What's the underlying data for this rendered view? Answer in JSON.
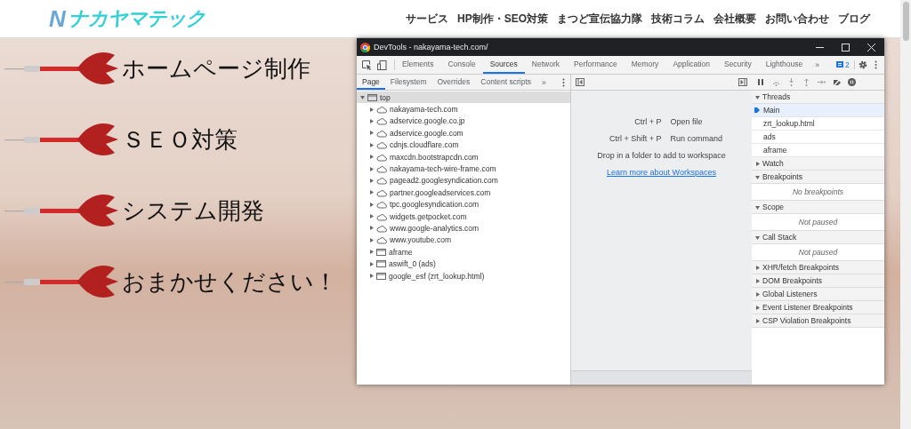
{
  "site_header": {
    "logo": {
      "initial": "N",
      "text": "ナカヤマテック"
    },
    "nav": [
      "サービス",
      "HP制作・SEO対策",
      "まつど宣伝協力隊",
      "技術コラム",
      "会社概要",
      "お問い合わせ",
      "ブログ"
    ]
  },
  "hero": {
    "items": [
      "ホームページ制作",
      "ＳＥＯ対策",
      "システム開発",
      "おまかせください！"
    ]
  },
  "devtools": {
    "title": "DevTools - nakayama-tech.com/",
    "tabs": [
      {
        "label": "Elements",
        "selected": false
      },
      {
        "label": "Console",
        "selected": false
      },
      {
        "label": "Sources",
        "selected": true
      },
      {
        "label": "Network",
        "selected": false
      },
      {
        "label": "Performance",
        "selected": false
      },
      {
        "label": "Memory",
        "selected": false
      },
      {
        "label": "Application",
        "selected": false
      },
      {
        "label": "Security",
        "selected": false
      },
      {
        "label": "Lighthouse",
        "selected": false
      }
    ],
    "more": "»",
    "issues_count": "2",
    "navigator": {
      "tabs": [
        {
          "label": "Page",
          "selected": true
        },
        {
          "label": "Filesystem",
          "selected": false
        },
        {
          "label": "Overrides",
          "selected": false
        },
        {
          "label": "Content scripts",
          "selected": false
        }
      ],
      "more": "»",
      "tree": [
        {
          "label": "top",
          "kind": "frame",
          "expanded": true,
          "selected": true,
          "children": [
            {
              "label": "nakayama-tech.com",
              "kind": "cloud",
              "expanded": false
            },
            {
              "label": "adservice.google.co.jp",
              "kind": "cloud",
              "expanded": false
            },
            {
              "label": "adservice.google.com",
              "kind": "cloud",
              "expanded": false
            },
            {
              "label": "cdnjs.cloudflare.com",
              "kind": "cloud",
              "expanded": false
            },
            {
              "label": "maxcdn.bootstrapcdn.com",
              "kind": "cloud",
              "expanded": false
            },
            {
              "label": "nakayama-tech-wire-frame.com",
              "kind": "cloud",
              "expanded": false
            },
            {
              "label": "pagead2.googlesyndication.com",
              "kind": "cloud",
              "expanded": false
            },
            {
              "label": "partner.googleadservices.com",
              "kind": "cloud",
              "expanded": false
            },
            {
              "label": "tpc.googlesyndication.com",
              "kind": "cloud",
              "expanded": false
            },
            {
              "label": "widgets.getpocket.com",
              "kind": "cloud",
              "expanded": false
            },
            {
              "label": "www.google-analytics.com",
              "kind": "cloud",
              "expanded": false
            },
            {
              "label": "www.youtube.com",
              "kind": "cloud",
              "expanded": false
            },
            {
              "label": "aframe",
              "kind": "frame",
              "expanded": false
            },
            {
              "label": "aswift_0 (ads)",
              "kind": "frame",
              "expanded": false
            },
            {
              "label": "google_esf (zrt_lookup.html)",
              "kind": "frame",
              "expanded": false
            }
          ]
        }
      ]
    },
    "editor": {
      "shortcuts": [
        {
          "keys": "Ctrl + P",
          "action": "Open file"
        },
        {
          "keys": "Ctrl + Shift + P",
          "action": "Run command"
        }
      ],
      "hint": "Drop in a folder to add to workspace",
      "link": "Learn more about Workspaces"
    },
    "debugger": {
      "sections": [
        {
          "title": "Threads",
          "expanded": true,
          "items": [
            {
              "label": "Main",
              "selected": true
            },
            {
              "label": "zrt_lookup.html",
              "selected": false
            },
            {
              "label": "ads",
              "selected": false
            },
            {
              "label": "aframe",
              "selected": false
            }
          ]
        },
        {
          "title": "Watch",
          "expanded": false
        },
        {
          "title": "Breakpoints",
          "expanded": true,
          "message": "No breakpoints"
        },
        {
          "title": "Scope",
          "expanded": true,
          "message": "Not paused"
        },
        {
          "title": "Call Stack",
          "expanded": true,
          "message": "Not paused"
        },
        {
          "title": "XHR/fetch Breakpoints",
          "expanded": false
        },
        {
          "title": "DOM Breakpoints",
          "expanded": false
        },
        {
          "title": "Global Listeners",
          "expanded": false
        },
        {
          "title": "Event Listener Breakpoints",
          "expanded": false
        },
        {
          "title": "CSP Violation Breakpoints",
          "expanded": false
        }
      ]
    }
  }
}
